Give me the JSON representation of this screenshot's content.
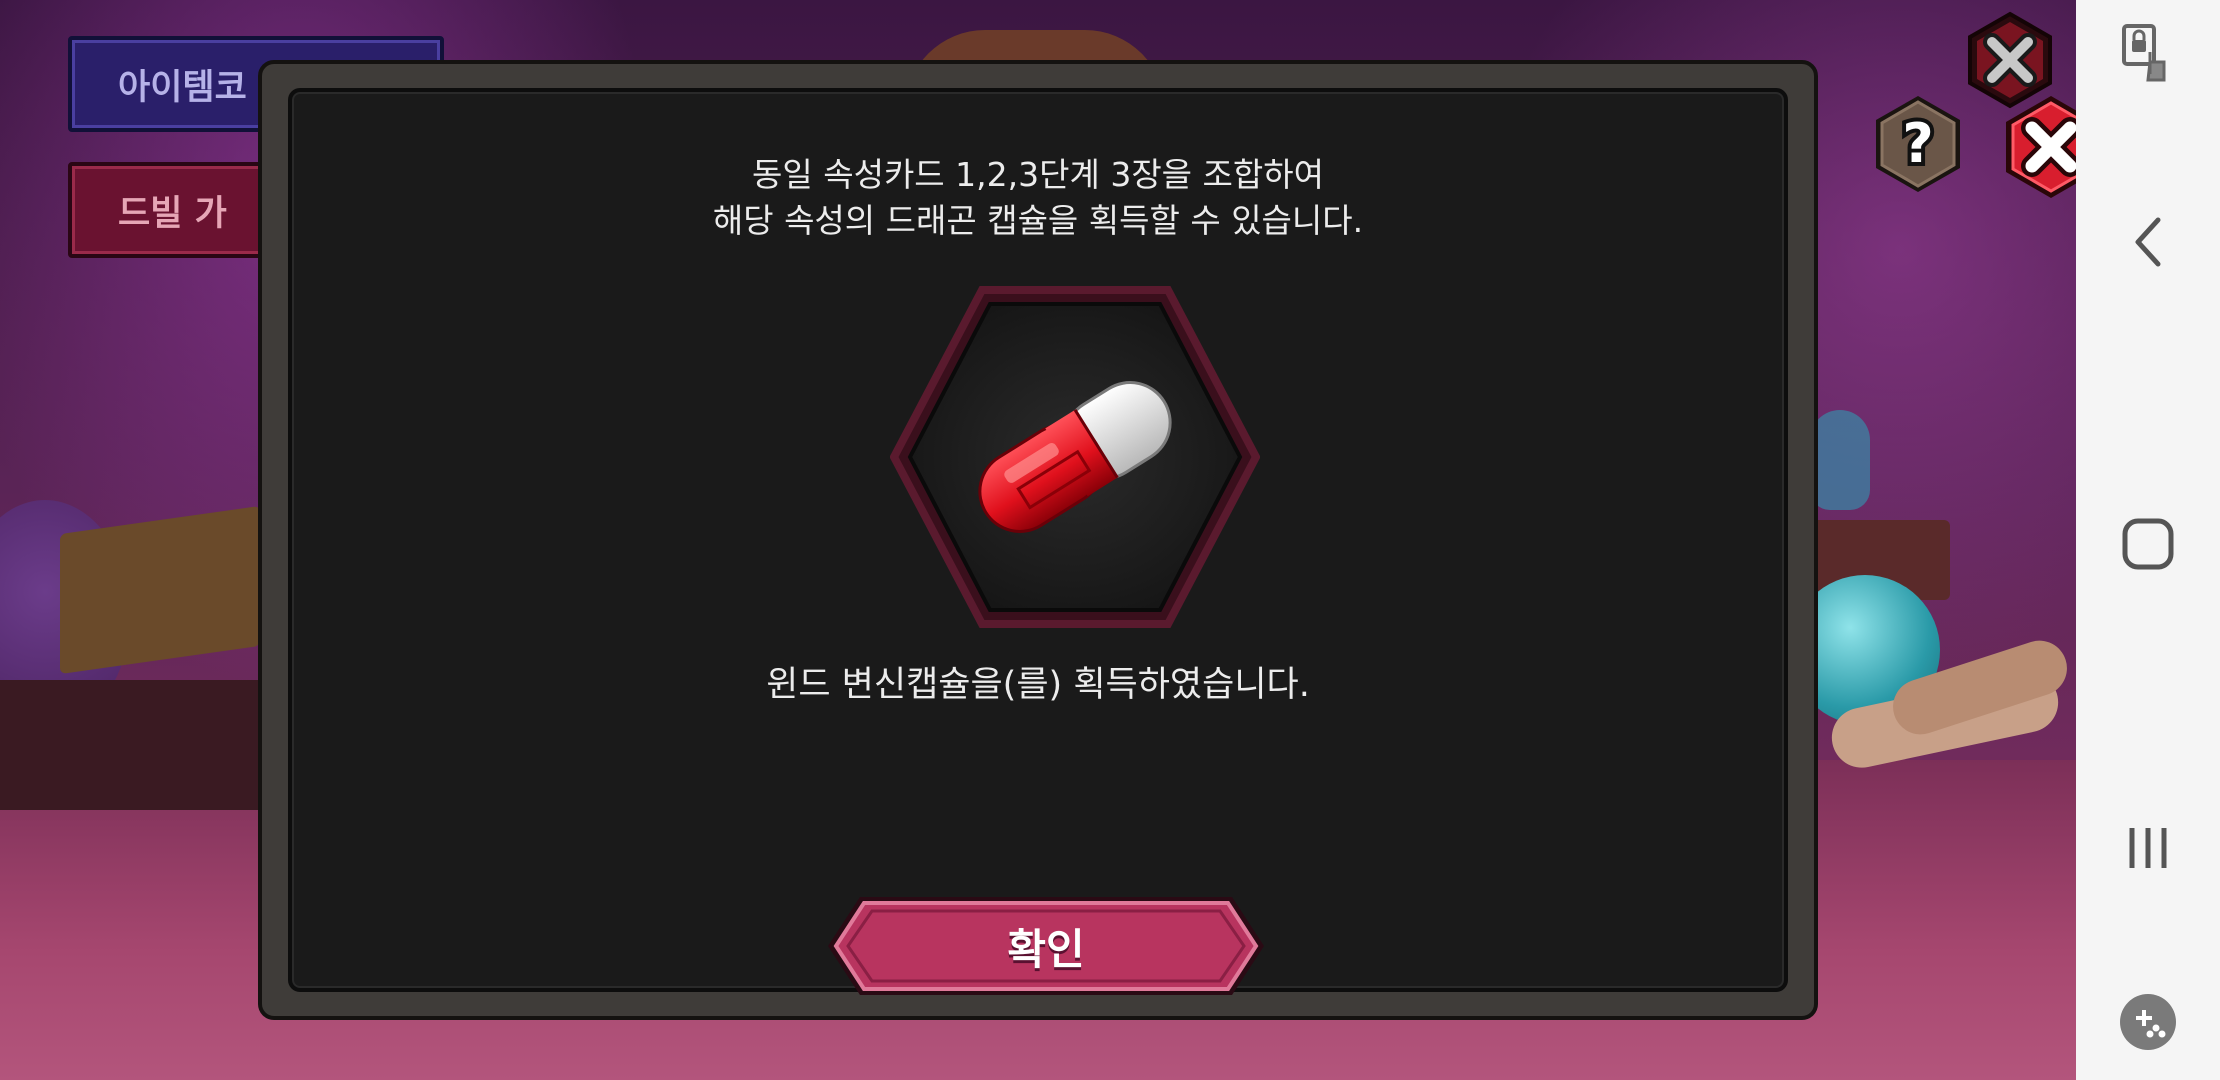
{
  "background": {
    "buttons": [
      {
        "label": "아이템코",
        "style": "blue"
      },
      {
        "label": "드빌 가",
        "style": "red"
      }
    ]
  },
  "dialog": {
    "description_lines": [
      "동일 속성카드 1,2,3단계 3장을 조합하여",
      "해당 속성의 드래곤 캡슐을 획득할 수 있습니다."
    ],
    "item": {
      "icon": "red-capsule-icon",
      "frame_color": "#5a1a2e",
      "capsule_colors": {
        "red": "#e0101c",
        "white": "#f0f0f0"
      }
    },
    "result_message": "윈드 변신캡슐을(를) 획득하였습니다.",
    "confirm_label": "확인",
    "help_icon": "question-mark-icon",
    "close_icon": "close-x-icon"
  },
  "navbar": {
    "items": [
      {
        "icon": "screen-lock-touch-icon"
      },
      {
        "icon": "back-chevron-icon"
      },
      {
        "icon": "home-square-icon"
      },
      {
        "icon": "recent-apps-icon"
      },
      {
        "icon": "game-tools-icon"
      }
    ]
  },
  "colors": {
    "dialog_bg": "#1a1a1a",
    "dialog_border": "#3f3c39",
    "confirm_button": "#b8345f",
    "close_button": "#d81e2e",
    "help_button": "#5a4a3e"
  }
}
